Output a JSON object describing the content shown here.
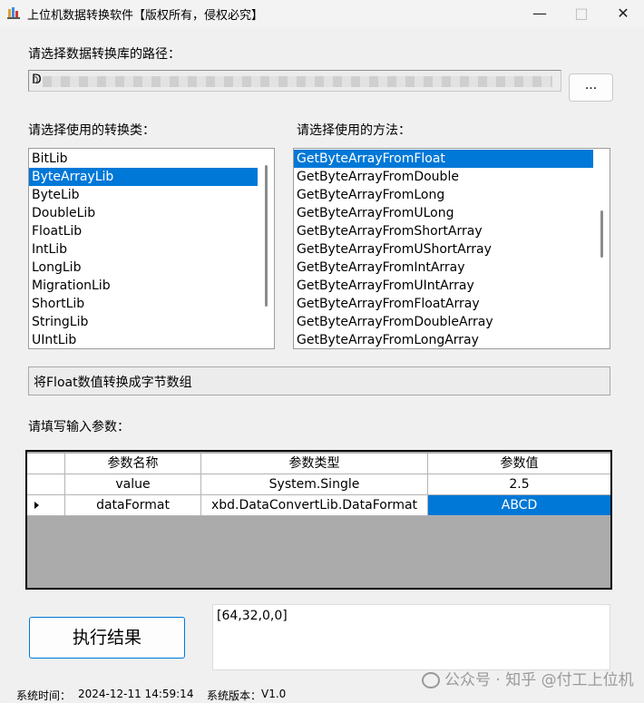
{
  "window": {
    "title": "上位机数据转换软件【版权所有，侵权必究】",
    "minimize": "—",
    "maximize": "□",
    "close": "✕"
  },
  "path_section": {
    "label": "请选择数据转换库的路径：",
    "path_start": "D:",
    "path_end": "ɔ",
    "browse_label": "..."
  },
  "class_list": {
    "label": "请选择使用的转换类：",
    "items": [
      "BitLib",
      "ByteArrayLib",
      "ByteLib",
      "DoubleLib",
      "FloatLib",
      "IntLib",
      "LongLib",
      "MigrationLib",
      "ShortLib",
      "StringLib",
      "UIntLib"
    ],
    "selected": "ByteArrayLib"
  },
  "method_list": {
    "label": "请选择使用的方法：",
    "items": [
      "GetByteArrayFromFloat",
      "GetByteArrayFromDouble",
      "GetByteArrayFromLong",
      "GetByteArrayFromULong",
      "GetByteArrayFromShortArray",
      "GetByteArrayFromUShortArray",
      "GetByteArrayFromIntArray",
      "GetByteArrayFromUIntArray",
      "GetByteArrayFromFloatArray",
      "GetByteArrayFromDoubleArray",
      "GetByteArrayFromLongArray"
    ],
    "selected": "GetByteArrayFromFloat"
  },
  "description": "将Float数值转换成字节数组",
  "params": {
    "label": "请填写输入参数：",
    "headers": [
      "参数名称",
      "参数类型",
      "参数值"
    ],
    "rows": [
      {
        "name": "value",
        "type": "System.Single",
        "value": "2.5"
      },
      {
        "name": "dataFormat",
        "type": "xbd.DataConvertLib.DataFormat",
        "value": "ABCD"
      }
    ]
  },
  "execute_label": "执行结果",
  "result": "[64,32,0,0]",
  "status": {
    "time_label": "系统时间：",
    "time_value": "2024-12-11 14:59:14",
    "version_label": "系统版本：",
    "version_value": "V1.0"
  },
  "watermark": "知乎 @付工上位机",
  "watermark_prefix": "公众号 ·",
  "colors": {
    "selection": "#0078d7",
    "background": "#f0f0f0"
  }
}
